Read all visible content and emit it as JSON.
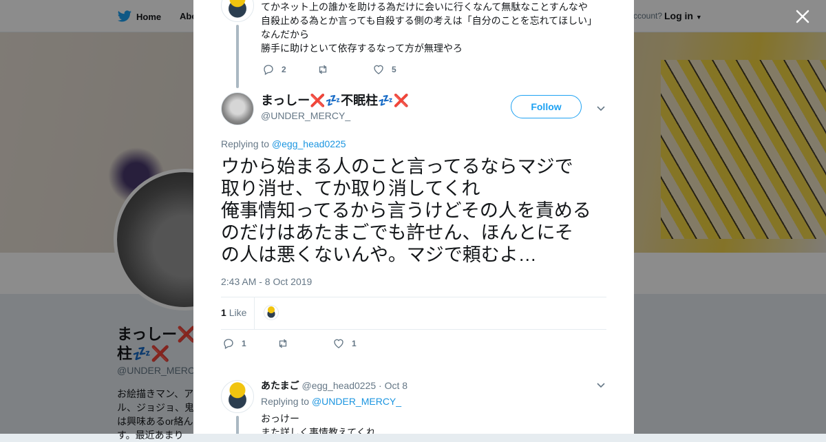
{
  "nav": {
    "home_label": "Home",
    "about_label": "Abo",
    "account_text": "ccount?",
    "login_label": "Log in"
  },
  "profile_bg": {
    "name": "まっしー❌💤不眠柱💤❌",
    "name_visible_line1": "まっしー❌",
    "name_visible_line2": "柱💤❌",
    "handle": "@UNDER_MERC",
    "bio_lines": [
      "お絵描きマン、ア",
      "ル、ジョジョ、鬼",
      "は興味あるor絡ん",
      "す。最近あまり"
    ]
  },
  "close_icon": "close-icon",
  "previous_tweet": {
    "lines": [
      "てかネット上の誰かを助ける為だけに会いに行くなんて無駄なことすんなや",
      "自殺止める為とか言っても自殺する側の考えは「自分のことを忘れてほしい」",
      "なんだから",
      "勝手に助けといて依存するなって方が無理やろ"
    ],
    "reply_count": "2",
    "retweet_count": "",
    "like_count": "5"
  },
  "main_tweet": {
    "display_name": "まっしー❌💤不眠柱💤❌",
    "handle": "@UNDER_MERCY_",
    "follow_label": "Follow",
    "replying_prefix": "Replying to",
    "replying_to": "@egg_head0225",
    "text_lines": [
      "ウから始まる人のこと言ってるならマジで",
      "取り消せ、てか取り消してくれ",
      "俺事情知ってるから言うけどその人を責める",
      "のだけはあたまごでも許せん、ほんとにそ",
      "の人は悪くないんや。マジで頼むよ…"
    ],
    "timestamp": "2:43 AM - 8 Oct 2019",
    "like_count": "1",
    "like_label": "Like",
    "reply_count": "1",
    "retweet_count": "",
    "favorite_count": "1"
  },
  "reply_tweet": {
    "display_name": "あたまご",
    "handle": "@egg_head0225",
    "date": "· Oct 8",
    "replying_prefix": "Replying to",
    "replying_to": "@UNDER_MERCY_",
    "lines": [
      "おっけー",
      "また詳しく事情教えてくれ"
    ]
  },
  "colors": {
    "accent": "#1da1f2",
    "link": "#1b95e0",
    "text": "#14171a",
    "muted": "#657786",
    "thread_line": "#aab8c2"
  }
}
